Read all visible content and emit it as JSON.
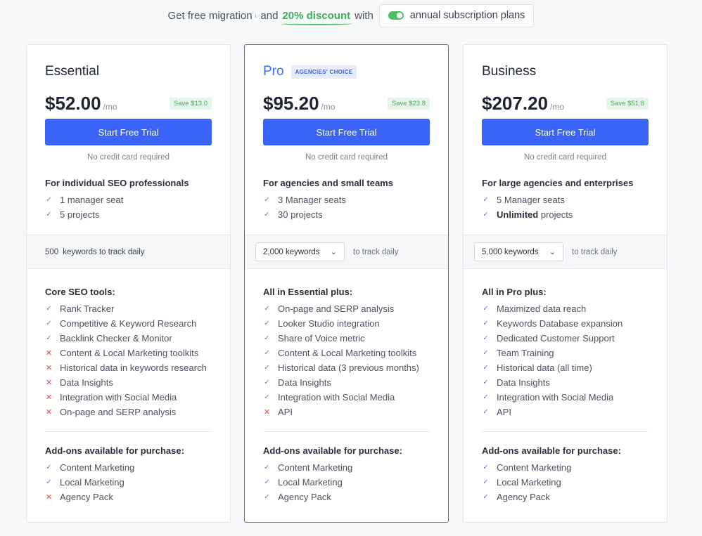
{
  "banner": {
    "text_before": "Get free migration",
    "footnote": "i",
    "and": "and",
    "discount": "20% discount",
    "with": "with",
    "toggle_label": "annual subscription plans"
  },
  "plans": [
    {
      "name": "Essential",
      "badge": "",
      "price": "$52.00",
      "per": "/mo",
      "save": "Save $13.0",
      "button": "Start Free Trial",
      "no_cc": "No credit card required",
      "audience": "For individual SEO professionals",
      "seats": [
        {
          "strong": "",
          "num": "1",
          "text": "manager seat"
        },
        {
          "strong": "",
          "num": "5",
          "text": "projects"
        }
      ],
      "keywords_num": "500",
      "keywords_label": "keywords to track daily",
      "features_title": "Core SEO tools:",
      "features": [
        {
          "ok": true,
          "text": "Rank Tracker"
        },
        {
          "ok": true,
          "text": "Competitive & Keyword Research"
        },
        {
          "ok": true,
          "text": "Backlink Checker & Monitor"
        },
        {
          "ok": false,
          "text": "Content & Local Marketing toolkits"
        },
        {
          "ok": false,
          "text": "Historical data in keywords research"
        },
        {
          "ok": false,
          "text": "Data Insights"
        },
        {
          "ok": false,
          "text": "Integration with Social Media"
        },
        {
          "ok": false,
          "text": "On-page and SERP analysis"
        }
      ],
      "addons_title": "Add-ons available for purchase:",
      "addons": [
        {
          "ok": true,
          "text": "Content Marketing"
        },
        {
          "ok": true,
          "text": "Local Marketing"
        },
        {
          "ok": false,
          "text": "Agency Pack"
        }
      ]
    },
    {
      "name": "Pro",
      "badge": "AGENCIES' CHOICE",
      "price": "$95.20",
      "per": "/mo",
      "save": "Save $23.8",
      "button": "Start Free Trial",
      "no_cc": "No credit card required",
      "audience": "For agencies and small teams",
      "seats": [
        {
          "strong": "",
          "num": "3",
          "text": "Manager seats"
        },
        {
          "strong": "",
          "num": "30",
          "text": "projects"
        }
      ],
      "keywords_select": "2,000 keywords",
      "keywords_label": "to track daily",
      "features_title": "All in Essential plus:",
      "features": [
        {
          "ok": true,
          "text": "On-page and SERP analysis"
        },
        {
          "ok": true,
          "text": "Looker Studio integration"
        },
        {
          "ok": true,
          "text": "Share of Voice metric"
        },
        {
          "ok": true,
          "text": "Content & Local Marketing toolkits"
        },
        {
          "ok": true,
          "text": "Historical data (3 previous months)"
        },
        {
          "ok": true,
          "text": "Data Insights"
        },
        {
          "ok": true,
          "text": "Integration with Social Media"
        },
        {
          "ok": false,
          "text": "API"
        }
      ],
      "addons_title": "Add-ons available for purchase:",
      "addons": [
        {
          "ok": true,
          "text": "Content Marketing"
        },
        {
          "ok": true,
          "text": "Local Marketing"
        },
        {
          "ok": true,
          "text": "Agency Pack"
        }
      ]
    },
    {
      "name": "Business",
      "badge": "",
      "price": "$207.20",
      "per": "/mo",
      "save": "Save $51.8",
      "button": "Start Free Trial",
      "no_cc": "No credit card required",
      "audience": "For large agencies and enterprises",
      "seats": [
        {
          "strong": "",
          "num": "5",
          "text": "Manager seats"
        },
        {
          "strong": "Unlimited",
          "num": "",
          "text": "projects"
        }
      ],
      "keywords_select": "5,000 keywords",
      "keywords_label": "to track daily",
      "features_title": "All in Pro plus:",
      "features": [
        {
          "ok": true,
          "text": "Maximized data reach"
        },
        {
          "ok": true,
          "text": "Keywords Database expansion"
        },
        {
          "ok": true,
          "text": "Dedicated Customer Support"
        },
        {
          "ok": true,
          "text": "Team Training"
        },
        {
          "ok": true,
          "text": "Historical data (all time)"
        },
        {
          "ok": true,
          "text": "Data Insights"
        },
        {
          "ok": true,
          "text": "Integration with Social Media"
        },
        {
          "ok": true,
          "text": "API"
        }
      ],
      "addons_title": "Add-ons available for purchase:",
      "addons": [
        {
          "ok": true,
          "text": "Content Marketing"
        },
        {
          "ok": true,
          "text": "Local Marketing"
        },
        {
          "ok": true,
          "text": "Agency Pack"
        }
      ]
    }
  ],
  "colors": {
    "accent": "#3a64f8",
    "check": "#5a7fd8",
    "cross": "#e0504b",
    "discount": "#3fae57"
  }
}
